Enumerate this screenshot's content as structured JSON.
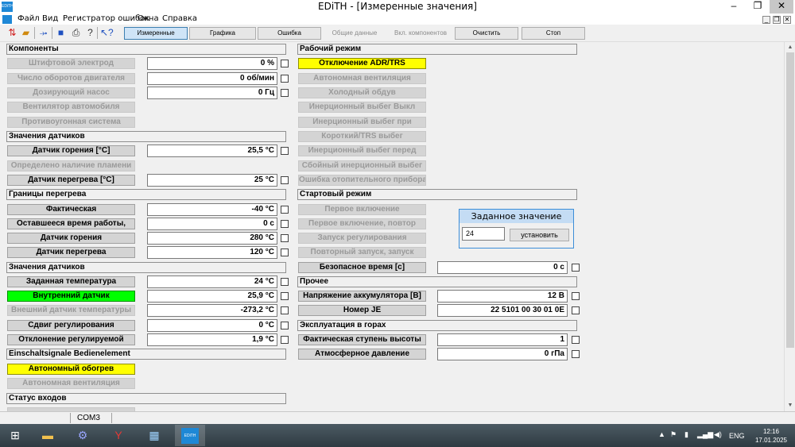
{
  "window": {
    "title": "EDiTH - [Измеренные значения]",
    "app_icon_text": "EDiTH",
    "minimize": "–",
    "maximize": "❐",
    "close": "✕"
  },
  "menu": {
    "items": [
      "Файл",
      "Вид",
      "Регистратор ошибок",
      "Окна",
      "Справка"
    ],
    "mdi_controls": [
      "_",
      "❐",
      "✕"
    ]
  },
  "toolbar": {
    "icons": [
      "sort-icon",
      "folder-icon",
      "plug-icon",
      "save-icon",
      "print-icon",
      "help-icon",
      "help-cursor-icon"
    ],
    "tabs": [
      {
        "label": "Измеренные значения",
        "state": "active"
      },
      {
        "label": "Графика",
        "state": "normal"
      },
      {
        "label": "Ошибка",
        "state": "normal"
      },
      {
        "label": "Общие данные",
        "state": "disabled"
      },
      {
        "label": "Вкл. компонентов",
        "state": "disabled"
      },
      {
        "label": "Очистить",
        "state": "normal"
      },
      {
        "label": "Стоп",
        "state": "normal"
      }
    ]
  },
  "left": {
    "sections": {
      "components": "Компоненты",
      "sensor_values": "Значения датчиков",
      "overheat_limits": "Границы перегрева",
      "sensor_values_2": "Значения датчиков",
      "einschaltsignale": "Einschaltsignale Bedienelement",
      "input_status": "Статус входов"
    },
    "rows": {
      "glow_pin": {
        "label": "Штифтовой электрод",
        "value": "0 %"
      },
      "engine_rpm": {
        "label": "Число оборотов двигателя",
        "value": "0 об/мин"
      },
      "dosing_pump": {
        "label": "Дозирующий насос",
        "value": "0 Гц"
      },
      "combustion_fan": {
        "label": "Вентилятор автомобиля"
      },
      "anti_theft": {
        "label": "Противоугонная система"
      },
      "flame_sensor": {
        "label": "Датчик горения [°C]",
        "value": "25,5 °C"
      },
      "flame_detected": {
        "label": "Определено наличие пламени"
      },
      "overheat_sensor": {
        "label": "Датчик перегрева [°C]",
        "value": "25 °C"
      },
      "actual": {
        "label": "Фактическая",
        "value": "-40 °C"
      },
      "remaining_time": {
        "label": "Оставшееся время работы,",
        "value": "0 с"
      },
      "flame_sensor_limit": {
        "label": "Датчик горения",
        "value": "280 °C"
      },
      "overheat_sensor_limit": {
        "label": "Датчик перегрева",
        "value": "120 °C"
      },
      "target_temp": {
        "label": "Заданная температура",
        "value": "24 °C"
      },
      "internal_sensor": {
        "label": "Внутренний датчик",
        "value": "25,9 °C"
      },
      "external_sensor": {
        "label": "Внешний датчик температуры",
        "value": "-273,2 °C"
      },
      "control_offset": {
        "label": "Сдвиг регулирования",
        "value": "0 °C"
      },
      "control_deviation": {
        "label": "Отклонение регулируемой",
        "value": "1,9 °C"
      },
      "auto_heating": {
        "label": "Автономный обогрев"
      },
      "auto_ventilation": {
        "label": "Автономная вентиляция"
      }
    }
  },
  "right": {
    "sections": {
      "operating_mode": "Рабочий режим",
      "start_mode": "Стартовый режим",
      "other": "Прочее",
      "mountain": "Эксплуатация в горах"
    },
    "rows": {
      "adr_shutdown": {
        "label": "Отключение ADR/TRS"
      },
      "auto_vent": {
        "label": "Автономная вентиляция"
      },
      "cold_blow": {
        "label": "Холодный обдув"
      },
      "inertia_off": {
        "label": "Инерционный выбег Выкл"
      },
      "inertia_at": {
        "label": "Инерционный выбег при"
      },
      "short_trs": {
        "label": "Короткий/TRS выбег"
      },
      "inertia_before": {
        "label": "Инерционный выбег перед"
      },
      "fault_inertia": {
        "label": "Сбойный инерционный выбег"
      },
      "heater_error": {
        "label": "Ошибка отопительного прибора"
      },
      "first_start": {
        "label": "Первое включение"
      },
      "first_start_repeat": {
        "label": "Первое включение, повтор"
      },
      "control_start": {
        "label": "Запуск регулирования"
      },
      "repeat_start": {
        "label": "Повторный запуск, запуск"
      },
      "safe_time": {
        "label": "Безопасное время [с]",
        "value": "0 с"
      },
      "battery_voltage": {
        "label": "Напряжение аккумулятора [В]",
        "value": "12 В"
      },
      "je_number": {
        "label": "Номер JE",
        "value": "22 5101 00 30 01 0E"
      },
      "altitude_step": {
        "label": "Фактическая ступень высоты",
        "value": "1"
      },
      "atm_pressure": {
        "label": "Атмосферное давление",
        "value": "0 гПа"
      }
    }
  },
  "popup": {
    "title": "Заданное значение",
    "input_value": "24",
    "button": "установить"
  },
  "statusbar": {
    "port": "COM3"
  },
  "taskbar": {
    "edith_tile": "EDiTH",
    "lang": "ENG",
    "time": "12:16",
    "date": "17.01.2025"
  },
  "colors": {
    "highlight_yellow": "#ffff00",
    "highlight_green": "#00ff00",
    "label_gray": "#d4d4d4"
  }
}
